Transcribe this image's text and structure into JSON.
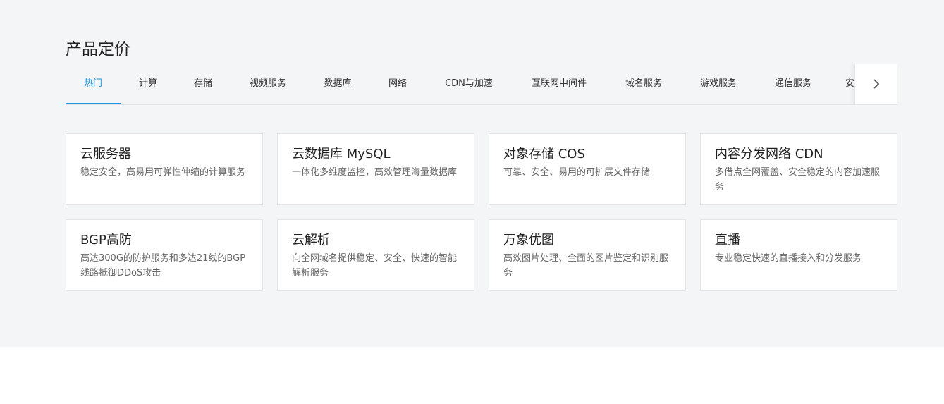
{
  "section": {
    "title": "产品定价"
  },
  "tabs": [
    {
      "label": "热门",
      "active": true
    },
    {
      "label": "计算"
    },
    {
      "label": "存储"
    },
    {
      "label": "视频服务"
    },
    {
      "label": "数据库"
    },
    {
      "label": "网络"
    },
    {
      "label": "CDN与加速"
    },
    {
      "label": "互联网中间件"
    },
    {
      "label": "域名服务"
    },
    {
      "label": "游戏服务"
    },
    {
      "label": "通信服务"
    },
    {
      "label": "安"
    }
  ],
  "tab_arrow_icon": "chevron-right-icon",
  "accent_color": "#1a99e6",
  "cards": [
    {
      "title": "云服务器",
      "desc": "稳定安全，高易用可弹性伸缩的计算服务"
    },
    {
      "title": "云数据库 MySQL",
      "desc": "一体化多维度监控，高效管理海量数据库"
    },
    {
      "title": "对象存储 COS",
      "desc": "可靠、安全、易用的可扩展文件存储"
    },
    {
      "title": "内容分发网络 CDN",
      "desc": "多借点全网覆盖、安全稳定的内容加速服务"
    },
    {
      "title": "BGP高防",
      "desc": "高达300G的防护服务和多达21线的BGP线路抵御DDoS攻击"
    },
    {
      "title": "云解析",
      "desc": "向全网域名提供稳定、安全、快速的智能解析服务"
    },
    {
      "title": "万象优图",
      "desc": "高效图片处理、全面的图片鉴定和识别服务"
    },
    {
      "title": "直播",
      "desc": "专业稳定快速的直播接入和分发服务"
    }
  ]
}
